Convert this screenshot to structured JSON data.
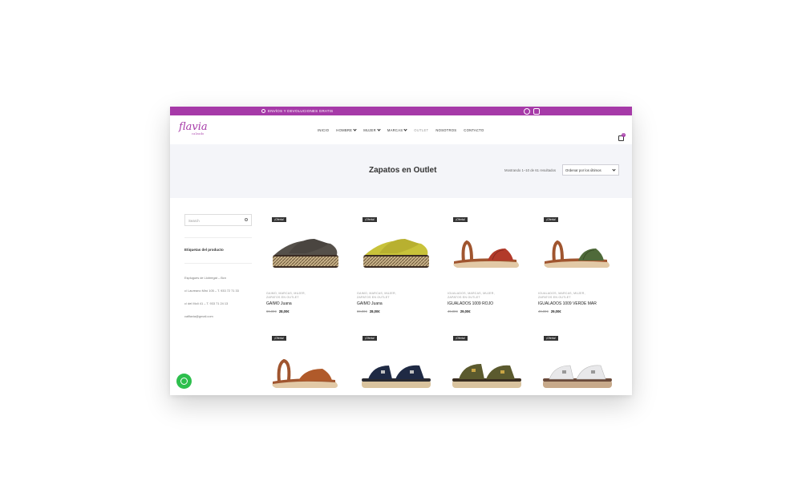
{
  "topbar": {
    "shipping_text": "ENVÍOS Y DEVOLUCIONES GRATIS",
    "social": [
      {
        "icon": "whatsapp-icon"
      },
      {
        "icon": "instagram-icon"
      }
    ]
  },
  "logo": {
    "name": "flavia",
    "tagline": "calzado"
  },
  "nav": {
    "items": [
      {
        "label": "INICIO",
        "has_menu": false
      },
      {
        "label": "HOMBRE",
        "has_menu": true
      },
      {
        "label": "MUJER",
        "has_menu": true
      },
      {
        "label": "MARCAS",
        "has_menu": true
      },
      {
        "label": "OUTLET",
        "has_menu": false,
        "active": true
      },
      {
        "label": "NOSOTROS",
        "has_menu": false
      },
      {
        "label": "CONTACTO",
        "has_menu": false
      }
    ],
    "cart_count": "0"
  },
  "banner": {
    "title": "Zapatos en Outlet",
    "result_count": "Mostrando 1–10 de 61 resultados",
    "sort_selected": "Ordenar por los últimos"
  },
  "sidebar": {
    "search_placeholder": "Search",
    "tags_title": "Etiquetas del producto",
    "info": [
      "Esplugues de Llobregat – Bcn",
      "c/ Laureano Miró 105 – T. 933 72 71 33",
      "c/ del Molí 41 – T. 933 71 24 13",
      "calflavia@gmail.com"
    ]
  },
  "products": [
    {
      "badge": "¡Oferta!",
      "cats": [
        "GAIMO",
        "MARCAS",
        "MUJER",
        "ZAPATOS EN OUTLET"
      ],
      "name": "GAIMO Juana",
      "old_price": "69,00€",
      "price": "28,00€"
    },
    {
      "badge": "¡Oferta!",
      "cats": [
        "GAIMO",
        "MARCAS",
        "MUJER",
        "ZAPATOS EN OUTLET"
      ],
      "name": "GAIMO Juana",
      "old_price": "69,00€",
      "price": "28,00€"
    },
    {
      "badge": "¡Oferta!",
      "cats": [
        "IGUALADOS",
        "MARCAS",
        "MUJER",
        "ZAPATOS EN OUTLET"
      ],
      "name": "IGUALADOS 1009 ROJO",
      "old_price": "49,00€",
      "price": "29,00€"
    },
    {
      "badge": "¡Oferta!",
      "cats": [
        "IGUALADOS",
        "MARCAS",
        "MUJER",
        "ZAPATOS EN OUTLET"
      ],
      "name": "IGUALADOS 1009 VERDE MAR",
      "old_price": "49,00€",
      "price": "29,00€"
    },
    {
      "badge": "¡Oferta!"
    },
    {
      "badge": "¡Oferta!"
    },
    {
      "badge": "¡Oferta!"
    },
    {
      "badge": "¡Oferta!"
    }
  ],
  "colors": {
    "brand": "#a63aa8",
    "banner_bg": "#f4f5f9",
    "whatsapp": "#2dbf4d"
  }
}
